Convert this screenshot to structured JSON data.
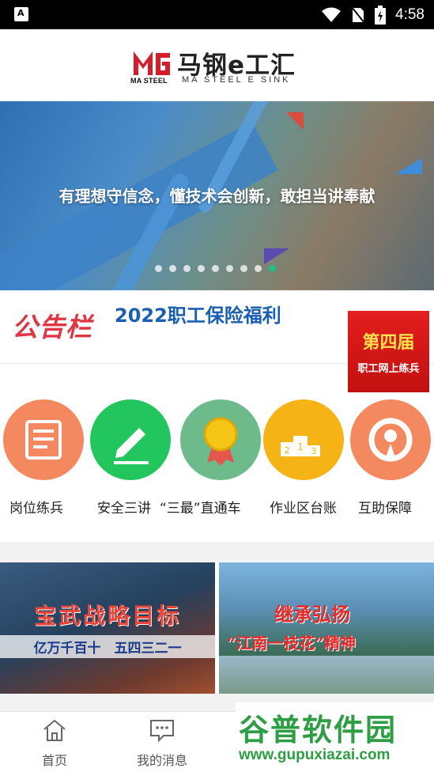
{
  "status_bar": {
    "time": "4:58"
  },
  "header": {
    "logo_cn": "马钢e工汇",
    "logo_en": "MA STEEL E SINK",
    "logo_mark_text": "MA STEEL"
  },
  "banner": {
    "slogan": "有理想守信念，懂技术会创新，敢担当讲奉献",
    "slide_count": 9,
    "active_slide": 9
  },
  "notice": {
    "logo": "公告栏",
    "text": "2022职工保险福利",
    "badge_line1": "第四届",
    "badge_line2": "职工网上练兵"
  },
  "features": [
    {
      "label": "岗位练兵",
      "icon": "scroll-icon",
      "color": "#f4895f"
    },
    {
      "label": "安全三讲",
      "icon": "pencil-icon",
      "color": "#22c55e"
    },
    {
      "label": "“三最”直通车",
      "icon": "medal-icon",
      "color": "#6dbb8a"
    },
    {
      "label": "作业区台账",
      "icon": "podium-icon",
      "color": "#f5b316"
    },
    {
      "label": "互助保障",
      "icon": "shield-person-icon",
      "color": "#f4895f"
    }
  ],
  "promos": {
    "left_title": "宝武战略目标",
    "left_subtitle": "亿万千百十　五四三二一",
    "right_title": "继承弘扬",
    "right_subtitle": "“江南一枝花”精神"
  },
  "bottom_nav": [
    {
      "label": "首页",
      "icon": "home-icon"
    },
    {
      "label": "我的消息",
      "icon": "message-icon"
    }
  ],
  "watermark": {
    "line1": "谷普软件园",
    "line2": "www.gupuxiazai.com"
  }
}
